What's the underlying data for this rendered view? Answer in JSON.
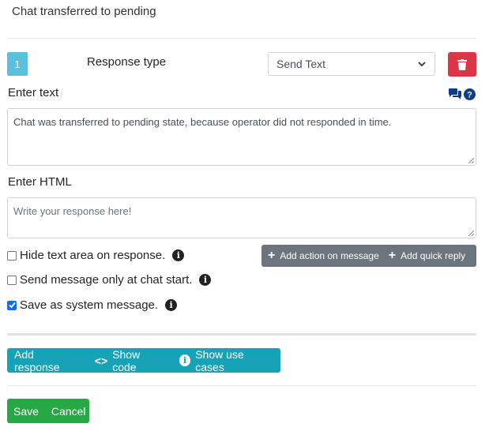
{
  "title": "Chat transferred to pending",
  "response": {
    "number": "1",
    "type_label": "Response type",
    "type_selected": "Send Text"
  },
  "enter_text": {
    "label": "Enter text",
    "value": "Chat was transferred to pending state, because operator did not responded in time."
  },
  "enter_html": {
    "label": "Enter HTML",
    "placeholder": "Write your response here!"
  },
  "options": [
    {
      "label": "Hide text area on response.",
      "checked": false
    },
    {
      "label": "Send message only at chat start.",
      "checked": false
    },
    {
      "label": "Save as system message.",
      "checked": true
    }
  ],
  "message_actions": {
    "add_action": "Add action on message",
    "add_quick_reply": "Add quick reply"
  },
  "toolbar": {
    "add_response": "Add response",
    "show_code": "Show code",
    "show_use_cases": "Show use cases"
  },
  "footer": {
    "save": "Save",
    "cancel": "Cancel"
  },
  "colors": {
    "delete": "#dc3545",
    "badge": "#5bc0de",
    "teal": "#17a2b8",
    "grey": "#6c757d",
    "green": "#28a745"
  },
  "icons": [
    "trash-icon",
    "comments-icon",
    "question-circle-icon",
    "info-icon",
    "plus-icon",
    "code-icon",
    "chevron-down-icon",
    "checkmark-icon"
  ]
}
